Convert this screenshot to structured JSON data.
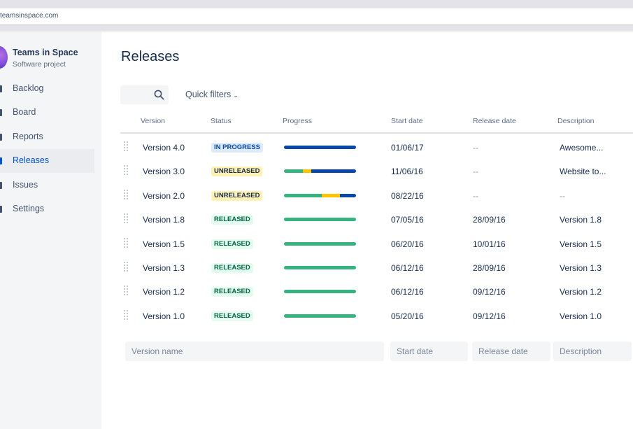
{
  "browser": {
    "url": "teamsinspace.com"
  },
  "sidebar": {
    "project_name": "Teams in Space",
    "project_type": "Software project",
    "items": [
      {
        "label": "Backlog",
        "icon": "backlog-icon"
      },
      {
        "label": "Board",
        "icon": "board-icon"
      },
      {
        "label": "Reports",
        "icon": "reports-icon"
      },
      {
        "label": "Releases",
        "icon": "releases-icon",
        "active": true
      },
      {
        "label": "Issues",
        "icon": "issues-icon"
      },
      {
        "label": "Settings",
        "icon": "settings-icon"
      }
    ]
  },
  "main": {
    "title": "Releases",
    "quick_filters": "Quick filters",
    "columns": [
      "Version",
      "Status",
      "Progress",
      "Start date",
      "Release date",
      "Description"
    ],
    "rows": [
      {
        "version": "Version 4.0",
        "status": "IN PROGRESS",
        "status_type": "inprogress",
        "progress": {
          "done": 0,
          "in_progress": 0,
          "todo": 1
        },
        "start": "01/06/17",
        "release": "--",
        "description": "Awesome..."
      },
      {
        "version": "Version 3.0",
        "status": "UNRELEASED",
        "status_type": "unreleased",
        "progress": {
          "done": 0.26,
          "in_progress": 0.12,
          "todo": 0.62
        },
        "start": "11/06/16",
        "release": "--",
        "description": "Website to..."
      },
      {
        "version": "Version 2.0",
        "status": "UNRELEASED",
        "status_type": "unreleased",
        "progress": {
          "done": 0.52,
          "in_progress": 0.26,
          "todo": 0.22
        },
        "start": "08/22/16",
        "release": "--",
        "description": "--"
      },
      {
        "version": "Version 1.8",
        "status": "RELEASED",
        "status_type": "released",
        "progress": {
          "done": 1,
          "in_progress": 0,
          "todo": 0
        },
        "start": "07/05/16",
        "release": "28/09/16",
        "description": "Version 1.8"
      },
      {
        "version": "Version 1.5",
        "status": "RELEASED",
        "status_type": "released",
        "progress": {
          "done": 1,
          "in_progress": 0,
          "todo": 0
        },
        "start": "06/20/16",
        "release": "10/01/16",
        "description": "Version 1.5"
      },
      {
        "version": "Version 1.3",
        "status": "RELEASED",
        "status_type": "released",
        "progress": {
          "done": 1,
          "in_progress": 0,
          "todo": 0
        },
        "start": "06/12/16",
        "release": "28/09/16",
        "description": "Version 1.3"
      },
      {
        "version": "Version 1.2",
        "status": "RELEASED",
        "status_type": "released",
        "progress": {
          "done": 1,
          "in_progress": 0,
          "todo": 0
        },
        "start": "06/12/16",
        "release": "09/12/16",
        "description": "Version 1.2"
      },
      {
        "version": "Version 1.0",
        "status": "RELEASED",
        "status_type": "released",
        "progress": {
          "done": 1,
          "in_progress": 0,
          "todo": 0
        },
        "start": "05/20/16",
        "release": "09/12/16",
        "description": "Version 1.0"
      }
    ],
    "new_version": {
      "name_placeholder": "Version name",
      "start_placeholder": "Start date",
      "release_placeholder": "Release date",
      "description_placeholder": "Description"
    }
  },
  "colors": {
    "accent": "#0052cc",
    "done": "#36b37e",
    "in_progress": "#ffc400",
    "todo": "#0747a6",
    "lozenge_inprogress_bg": "#deebff",
    "lozenge_inprogress_fg": "#0747a6",
    "lozenge_unreleased_bg": "#fff0b3",
    "lozenge_unreleased_fg": "#172b4d",
    "lozenge_released_bg": "#e3fcef",
    "lozenge_released_fg": "#006644"
  }
}
